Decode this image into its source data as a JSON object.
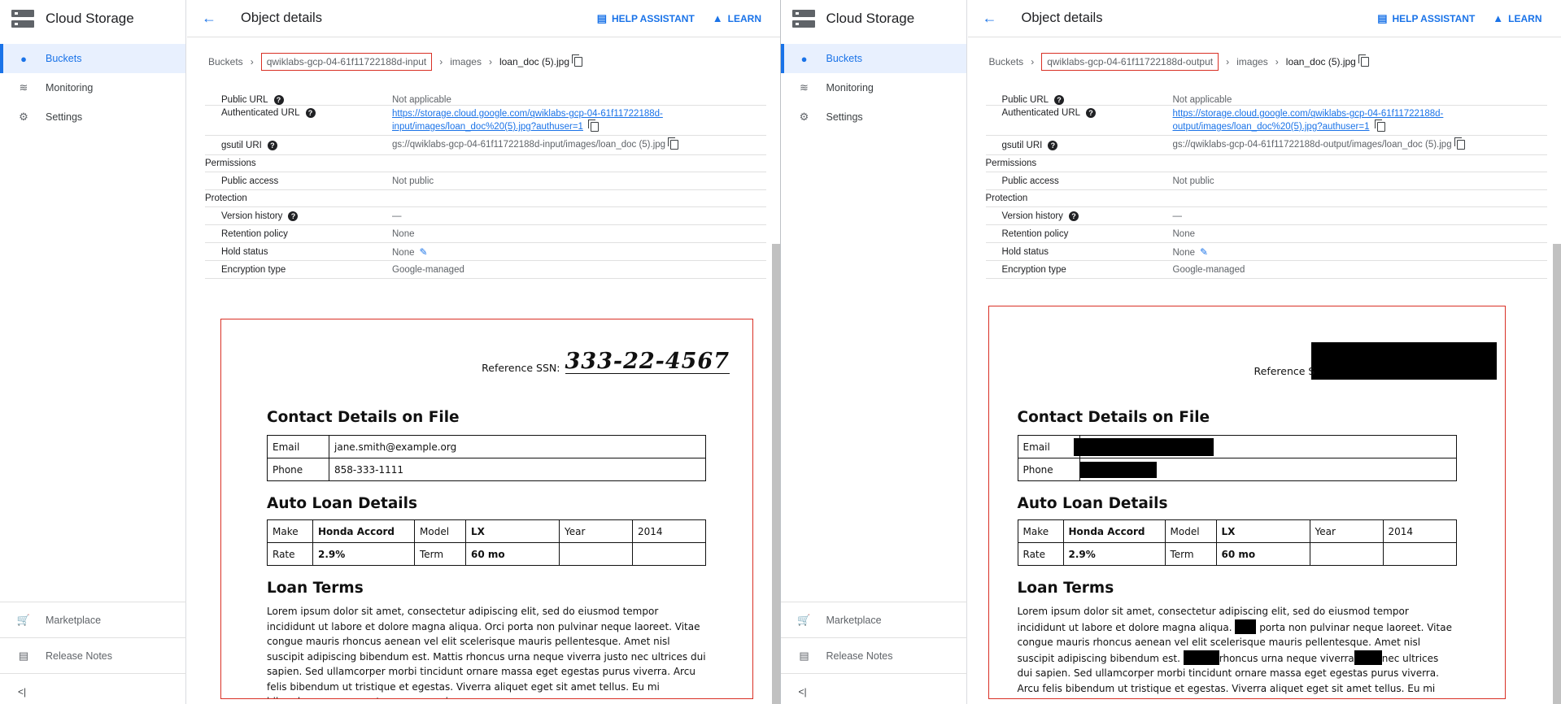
{
  "app": {
    "title": "Cloud Storage"
  },
  "sidebar": {
    "items": [
      {
        "label": "Buckets",
        "icon": "bucket-icon"
      },
      {
        "label": "Monitoring",
        "icon": "chart-icon"
      },
      {
        "label": "Settings",
        "icon": "gear-icon"
      }
    ],
    "bottom": [
      {
        "label": "Marketplace",
        "icon": "cart-icon"
      },
      {
        "label": "Release Notes",
        "icon": "notes-icon"
      }
    ],
    "collapse_label": "<|"
  },
  "header": {
    "title": "Object details",
    "help_label": "HELP ASSISTANT",
    "learn_label": "LEARN"
  },
  "left": {
    "breadcrumb": {
      "root": "Buckets",
      "bucket": "qwiklabs-gcp-04-61f11722188d-input",
      "folder": "images",
      "file": "loan_doc (5).jpg"
    },
    "details": {
      "public_url_label": "Public URL",
      "public_url_value": "Not applicable",
      "auth_url_label": "Authenticated URL",
      "auth_url_line1": "https://storage.cloud.google.com/qwiklabs-gcp-04-61f11722188d-",
      "auth_url_line2": "input/images/loan_doc%20(5).jpg?authuser=1",
      "gsutil_label": "gsutil URI",
      "gsutil_value": "gs://qwiklabs-gcp-04-61f11722188d-input/images/loan_doc (5).jpg",
      "permissions": "Permissions",
      "public_access_label": "Public access",
      "public_access_value": "Not public",
      "protection": "Protection",
      "version_label": "Version history",
      "version_value": "—",
      "retention_label": "Retention policy",
      "retention_value": "None",
      "hold_label": "Hold status",
      "hold_value": "None",
      "encryption_label": "Encryption type",
      "encryption_value": "Google-managed"
    }
  },
  "right": {
    "breadcrumb": {
      "root": "Buckets",
      "bucket": "qwiklabs-gcp-04-61f11722188d-output",
      "folder": "images",
      "file": "loan_doc (5).jpg"
    },
    "details": {
      "public_url_label": "Public URL",
      "public_url_value": "Not applicable",
      "auth_url_label": "Authenticated URL",
      "auth_url_line1": "https://storage.cloud.google.com/qwiklabs-gcp-04-61f11722188d-",
      "auth_url_line2": "output/images/loan_doc%20(5).jpg?authuser=1",
      "gsutil_label": "gsutil URI",
      "gsutil_value": "gs://qwiklabs-gcp-04-61f11722188d-output/images/loan_doc (5).jpg",
      "permissions": "Permissions",
      "public_access_label": "Public access",
      "public_access_value": "Not public",
      "protection": "Protection",
      "version_label": "Version history",
      "version_value": "—",
      "retention_label": "Retention policy",
      "retention_value": "None",
      "hold_label": "Hold status",
      "hold_value": "None",
      "encryption_label": "Encryption type",
      "encryption_value": "Google-managed"
    }
  },
  "document": {
    "ref_label": "Reference SSN:",
    "ref_label_redacted": "Reference S",
    "ssn": "333-22-4567",
    "contact_title": "Contact Details on File",
    "email_label": "Email",
    "email_value": "jane.smith@example.org",
    "phone_label": "Phone",
    "phone_value": "858-333-1111",
    "loan_title": "Auto Loan Details",
    "make_label": "Make",
    "make_value": "Honda Accord",
    "model_label": "Model",
    "model_value": "LX",
    "year_label": "Year",
    "year_value": "2014",
    "rate_label": "Rate",
    "rate_value": "2.9%",
    "term_label": "Term",
    "term_value": "60 mo",
    "terms_title": "Loan Terms",
    "para_original": "Lorem ipsum dolor sit amet, consectetur adipiscing elit, sed do eiusmod tempor incididunt ut labore et dolore magna aliqua. Orci porta non pulvinar neque laoreet. Vitae congue mauris rhoncus aenean vel elit scelerisque mauris pellentesque. Amet nisl suscipit adipiscing bibendum est. Mattis rhoncus urna neque viverra justo nec ultrices dui sapien. Sed ullamcorper morbi tincidunt ornare massa eget egestas purus viverra. Arcu felis bibendum ut tristique et egestas. Viverra aliquet eget sit amet tellus. Eu mi bibendum neque egestas congue quisque",
    "para_r1": "Lorem ipsum dolor sit amet, consectetur adipiscing elit, sed do eiusmod tempor incididunt ut labore et dolore magna aliqua. ",
    "para_r2": " porta non pulvinar neque laoreet. Vitae congue mauris rhoncus aenean vel elit scelerisque mauris pellentesque. Amet nisl suscipit adipiscing bibendum est. ",
    "para_r3": "rhoncus urna neque viverra",
    "para_r4": "nec ultrices dui sapien. Sed ullamcorper morbi tincidunt ornare massa eget egestas purus viverra. Arcu felis bibendum ut tristique et egestas. Viverra aliquet eget sit amet tellus. Eu mi bibendum neque egestas congue quisque"
  }
}
